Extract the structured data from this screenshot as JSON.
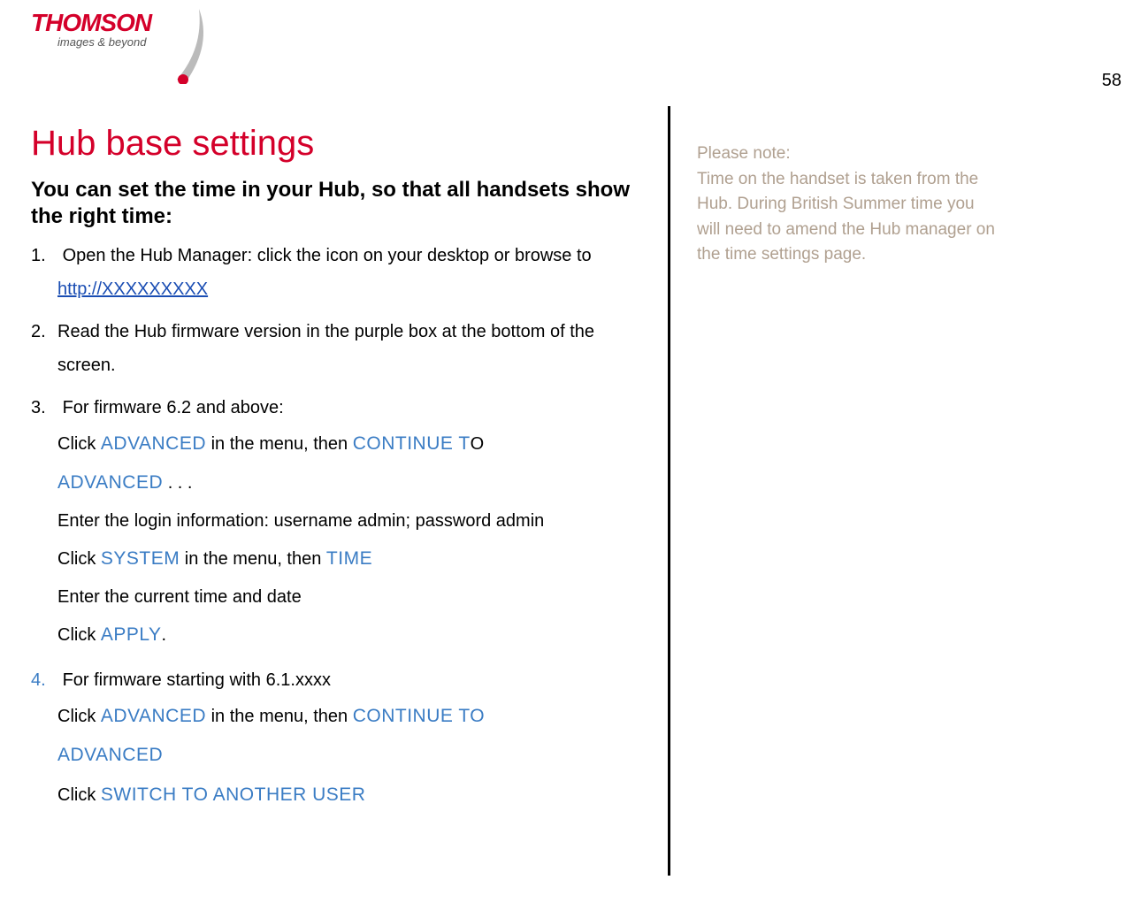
{
  "logo": {
    "brand": "THOMSON",
    "tagline": "images & beyond"
  },
  "page_number": "58",
  "main": {
    "title": "Hub base settings",
    "subtitle": "You can set the time in your Hub, so that all handsets show the right time:",
    "step1": {
      "text_a": "Open the Hub Manager:  click the icon on your desktop or browse to ",
      "link": "http://XXXXXXXXX"
    },
    "step2": "Read the Hub firmware version in the purple box at the bottom of the screen.",
    "step3": {
      "intro": "For firmware 6.2 and above:",
      "l1_a": "Click ",
      "l1_b": "ADVANCED",
      "l1_c": " in the menu, then ",
      "l1_d": "CONTINUE T",
      "l1_e": "O",
      "l2_a": "ADVANCED",
      "l2_b": " . . .",
      "l3": "Enter the login information:  username admin; password admin",
      "l4_a": "Click ",
      "l4_b": "SYSTEM",
      "l4_c": " in the menu, then ",
      "l4_d": "TIME",
      "l5": "Enter the current time and date",
      "l6_a": "Click ",
      "l6_b": "APPLY",
      "l6_c": "."
    },
    "step4": {
      "intro": "For firmware starting with 6.1.xxxx",
      "l1_a": "Click ",
      "l1_b": "ADVANCED",
      "l1_c": " in the menu, then ",
      "l1_d": "CONTINUE TO",
      "l2_a": "ADVANCED",
      "l3_a": "Click ",
      "l3_b": "SWITCH TO ANOTHER USER"
    }
  },
  "side": {
    "note_title": "Please note:",
    "note_body": "Time on the handset is taken from the Hub. During British Summer time you will need to amend the Hub manager on the time settings page."
  }
}
